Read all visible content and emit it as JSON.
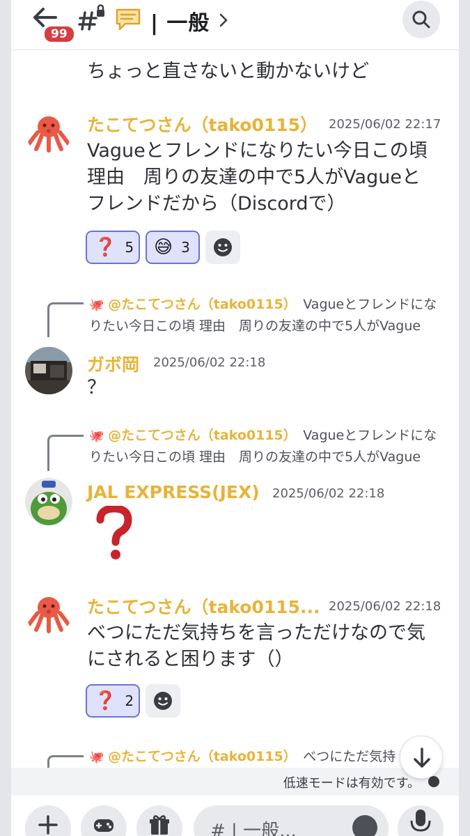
{
  "header": {
    "badge_count": "99",
    "channel_name": "| 一般"
  },
  "messages": [
    {
      "text": "ちょっと直さないと動かないけど"
    },
    {
      "author": "たこてつさん（tako0115）",
      "timestamp": "2025/06/02 22:17",
      "text": "Vagueとフレンドになりたい今日この頃 理由　周りの友達の中で5人がVagueとフレンドだから（Discordで）",
      "reactions": [
        {
          "emoji": "❓",
          "count": "5"
        },
        {
          "emoji": "😅",
          "count": "3"
        }
      ]
    },
    {
      "reply_mention": "@たこてつさん（tako0115）",
      "reply_snippet": "Vagueとフレンドになりたい今日この頃 理由　周りの友達の中で5人がVague",
      "author": "ガボ岡",
      "timestamp": "2025/06/02 22:18",
      "text": "？"
    },
    {
      "reply_mention": "@たこてつさん（tako0115）",
      "reply_snippet": "Vagueとフレンドになりたい今日この頃 理由　周りの友達の中で5人がVague",
      "author": "JAL EXPRESS(JEX)",
      "timestamp": "2025/06/02 22:18"
    },
    {
      "author": "たこてつさん（tako0115...",
      "timestamp": "2025/06/02 22:18",
      "text": "べつにただ気持ちを言っただけなので気にされると困ります（）",
      "reactions": [
        {
          "emoji": "❓",
          "count": "2"
        }
      ]
    },
    {
      "reply_mention": "@たこてつさん（tako0115）",
      "reply_snippet": "べつにただ気持ち"
    }
  ],
  "slowmode_text": "低速モードは有効です。",
  "composer": {
    "placeholder": "#  | 一般..."
  },
  "colors": {
    "author": "#e8b339",
    "reaction_bg": "#dfe2fb",
    "reaction_border": "#6a72d8",
    "badge": "#d83c3e"
  }
}
